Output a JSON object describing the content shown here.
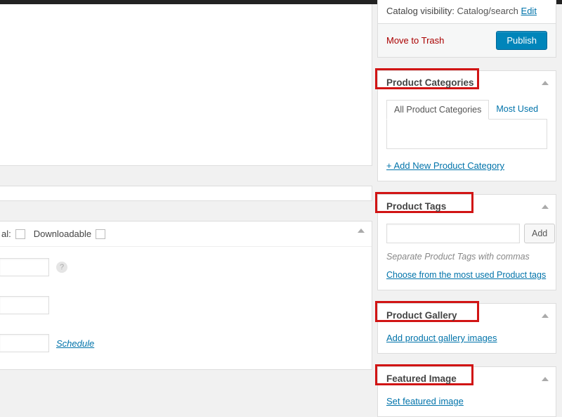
{
  "publish": {
    "catalog_label": "Catalog visibility:",
    "catalog_value": "Catalog/search",
    "edit": "Edit",
    "trash": "Move to Trash",
    "publish": "Publish"
  },
  "left": {
    "downloadable": "Downloadable",
    "partial_label_suffix": "al:",
    "schedule": "Schedule"
  },
  "cats": {
    "title": "Product Categories",
    "tab_all": "All Product Categories",
    "tab_used": "Most Used",
    "add": "+ Add New Product Category"
  },
  "tags": {
    "title": "Product Tags",
    "add_btn": "Add",
    "hint": "Separate Product Tags with commas",
    "choose": "Choose from the most used Product tags"
  },
  "gallery": {
    "title": "Product Gallery",
    "link": "Add product gallery images"
  },
  "featured": {
    "title": "Featured Image",
    "link": "Set featured image"
  }
}
